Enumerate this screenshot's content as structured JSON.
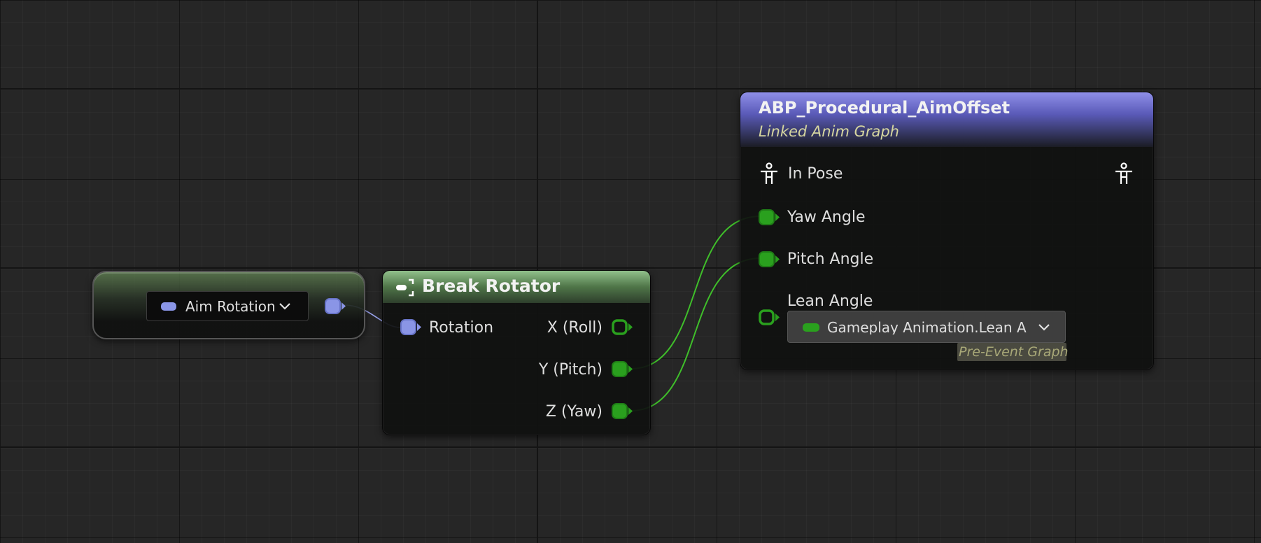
{
  "variable_node": {
    "name": "Aim Rotation",
    "type_color": "#8a95e6"
  },
  "break_rotator": {
    "title": "Break Rotator",
    "input_label": "Rotation",
    "outputs": [
      "X (Roll)",
      "Y (Pitch)",
      "Z (Yaw)"
    ],
    "header_color": "#6a9a62"
  },
  "linked_anim_graph": {
    "title": "ABP_Procedural_AimOffset",
    "subtitle": "Linked Anim Graph",
    "header_color": "#6a6ad6",
    "pose_input": "In Pose",
    "inputs": [
      "Yaw Angle",
      "Pitch Angle",
      "Lean Angle"
    ],
    "lean_binding": "Gameplay Animation.Lean Angle",
    "lean_binding_context": "Pre-Event Graph"
  },
  "colors": {
    "float_pin": "#2aa01e",
    "float_wire": "#3fbf2a",
    "rotator_pin": "#8a95e6",
    "rotator_wire": "#9aa4ee"
  },
  "icons": {
    "pose": "person-pose-icon",
    "break": "break-struct-icon",
    "dropdown": "chevron-down-icon"
  }
}
